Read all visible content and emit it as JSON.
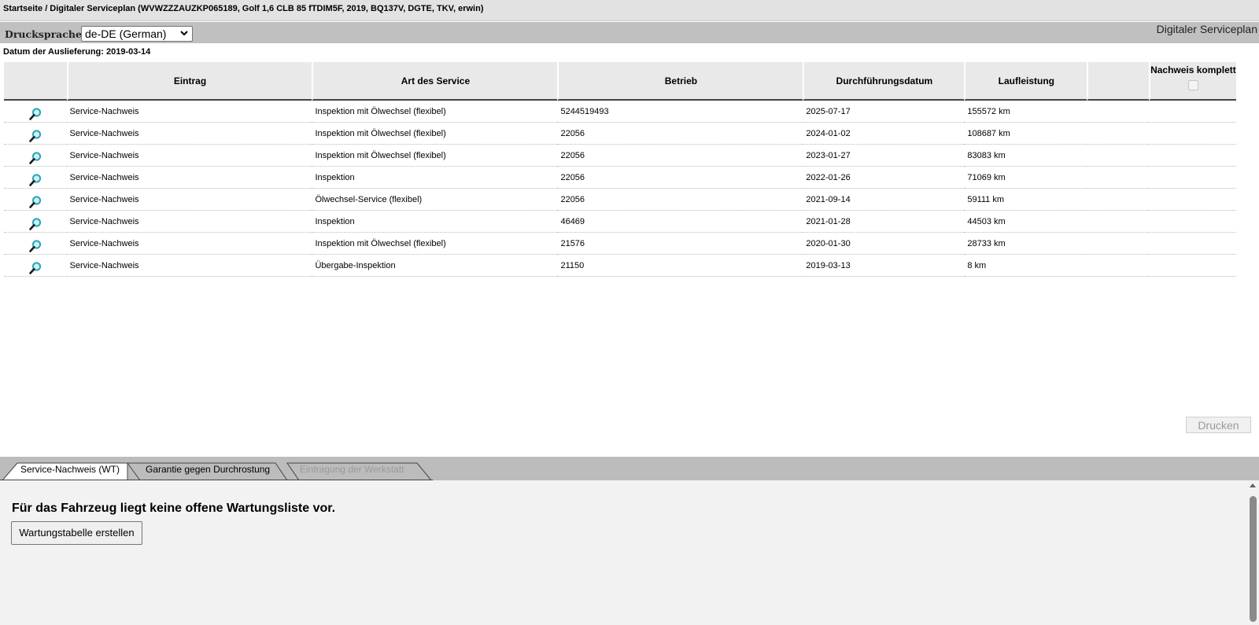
{
  "header": {
    "breadcrumb": "Startseite / Digitaler Serviceplan (WVWZZZAUZKP065189, Golf 1,6 CLB 85 fTDIM5F, 2019, BQ137V, DGTE, TKV, erwin)"
  },
  "toolbar": {
    "print_language_label": "Druckspr​ache:",
    "print_language_value": "de-DE (German)",
    "app_title": "Digitaler Serviceplan"
  },
  "delivery_date": "Datum der Auslieferung: 2019-03-14",
  "table": {
    "columns": {
      "icon": "",
      "entry": "Eintrag",
      "service_type": "Art des Service",
      "dealer": "Betrieb",
      "date": "Durchführungsdatum",
      "mileage": "Laufleistung",
      "blank": "",
      "proof_complete": "Nachweis komplett"
    },
    "rows": [
      {
        "entry": "Service-Nachweis",
        "service_type": "Inspektion mit Ölwechsel (flexibel)",
        "dealer": "5244519493",
        "date": "2025-07-17",
        "mileage": "155572 km"
      },
      {
        "entry": "Service-Nachweis",
        "service_type": "Inspektion mit Ölwechsel (flexibel)",
        "dealer": "22056",
        "date": "2024-01-02",
        "mileage": "108687 km"
      },
      {
        "entry": "Service-Nachweis",
        "service_type": "Inspektion mit Ölwechsel (flexibel)",
        "dealer": "22056",
        "date": "2023-01-27",
        "mileage": "83083 km"
      },
      {
        "entry": "Service-Nachweis",
        "service_type": "Inspektion",
        "dealer": "22056",
        "date": "2022-01-26",
        "mileage": "71069 km"
      },
      {
        "entry": "Service-Nachweis",
        "service_type": "Ölwechsel-Service (flexibel)",
        "dealer": "22056",
        "date": "2021-09-14",
        "mileage": "59111 km"
      },
      {
        "entry": "Service-Nachweis",
        "service_type": "Inspektion",
        "dealer": "46469",
        "date": "2021-01-28",
        "mileage": "44503 km"
      },
      {
        "entry": "Service-Nachweis",
        "service_type": "Inspektion mit Ölwechsel (flexibel)",
        "dealer": "21576",
        "date": "2020-01-30",
        "mileage": "28733 km"
      },
      {
        "entry": "Service-Nachweis",
        "service_type": "Übergabe-Inspektion",
        "dealer": "21150",
        "date": "2019-03-13",
        "mileage": "8 km"
      }
    ],
    "row_icon": "magnifier-icon"
  },
  "print_button": "Drucken",
  "tabs": [
    {
      "label": "Service-Nachweis (WT)",
      "state": "active"
    },
    {
      "label": "Garantie gegen Durchrostung",
      "state": "normal"
    },
    {
      "label": "Eintragung der Werkstatt",
      "state": "disabled"
    }
  ],
  "bottom": {
    "message": "Für das Fahrzeug liegt keine offene Wartungsliste vor.",
    "create_button": "Wartungstabelle erstellen"
  },
  "colors": {
    "header_bg": "#e2e2e2",
    "toolbar_bg": "#c0c0c0",
    "table_header_bg": "#e9e9e9",
    "icon_teal": "#2aa6b4",
    "panel_bg": "#f2f2f2"
  }
}
